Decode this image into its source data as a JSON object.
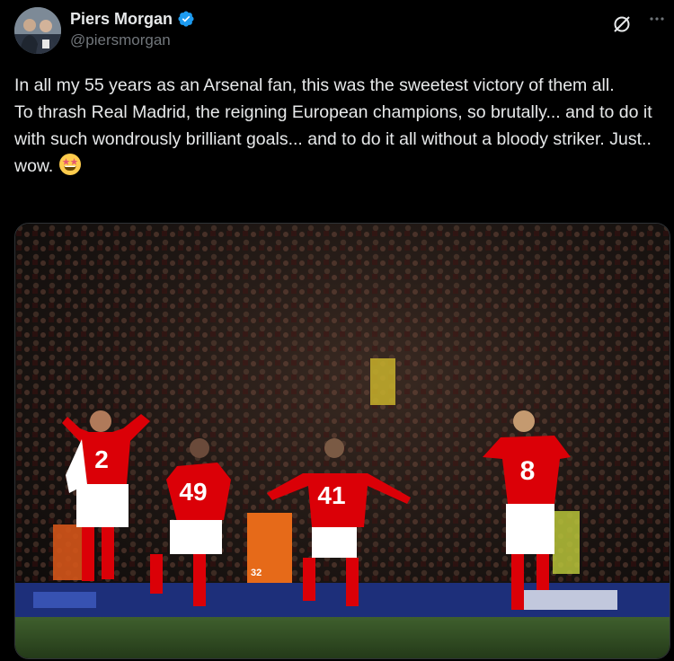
{
  "author": {
    "display_name": "Piers Morgan",
    "handle": "@piersmorgan",
    "verified": true,
    "avatar_icon": "avatar-photo",
    "verified_icon": "verified-badge-icon"
  },
  "actions": {
    "grok_icon": "grok-icon",
    "more_icon": "more-options-icon"
  },
  "tweet": {
    "line_1": "In all my 55 years as an Arsenal fan, this was the sweetest victory of them all.",
    "line_2": "To thrash Real Madrid, the reigning European champions, so brutally... and to do it with such wondrously brilliant goals... and to do it all without a bloody striker. Just.. wow.",
    "emoji": "star-struck-emoji"
  },
  "media": {
    "players": [
      {
        "number": "2"
      },
      {
        "number": "49"
      },
      {
        "number": "41"
      },
      {
        "number": "8"
      }
    ],
    "steward_badge": "32"
  },
  "colors": {
    "background": "#000000",
    "text": "#e7e9ea",
    "secondary_text": "#71767b",
    "verified_blue": "#1d9bf0",
    "arsenal_red": "#db0007"
  }
}
